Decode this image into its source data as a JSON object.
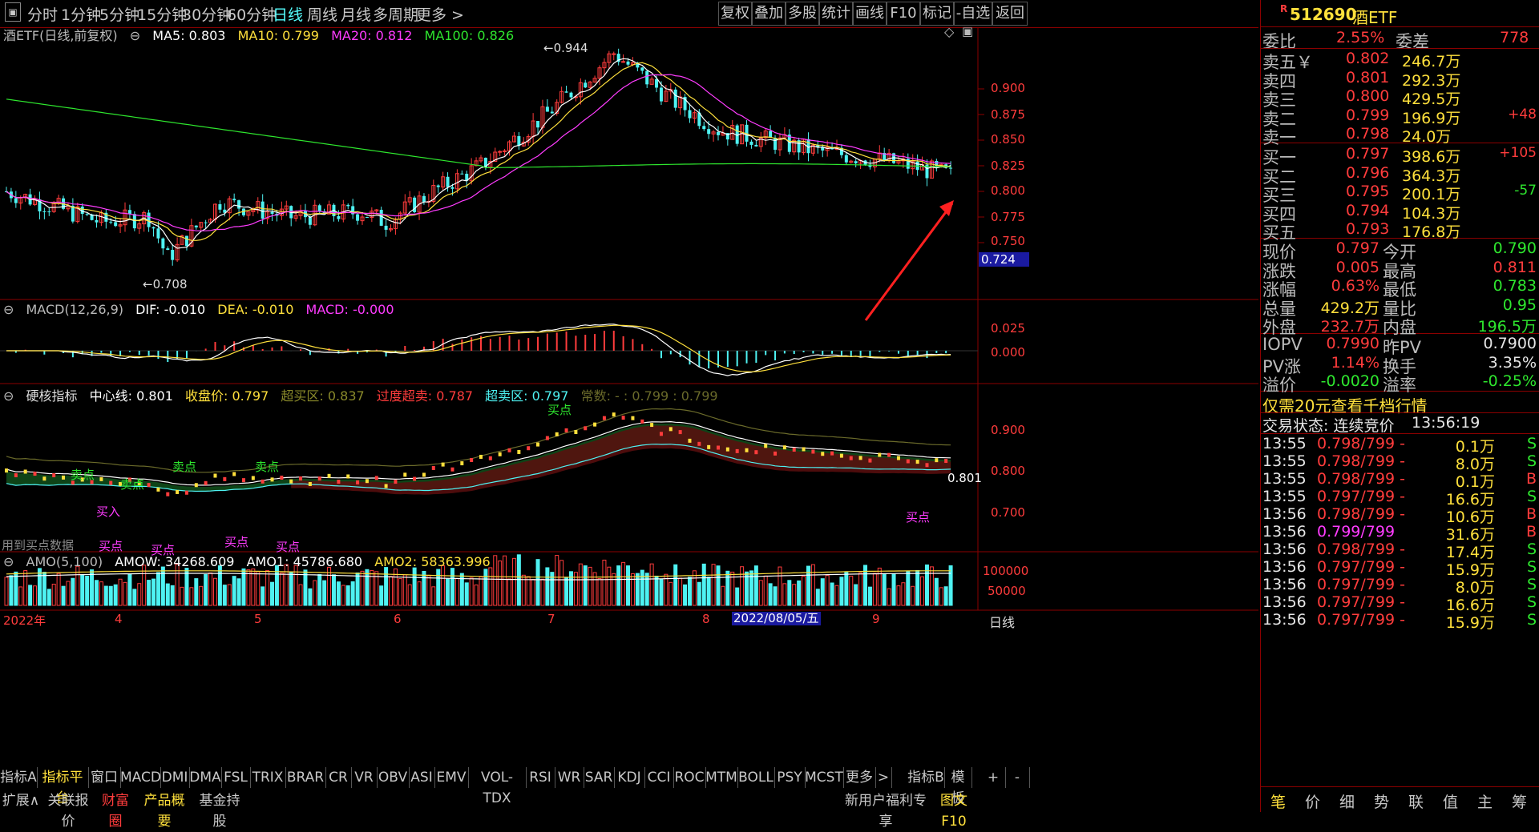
{
  "topbar": {
    "timeframes": [
      "分时",
      "1分钟",
      "5分钟",
      "15分钟",
      "30分钟",
      "60分钟",
      "日线",
      "周线",
      "月线",
      "多周期",
      "更多 >"
    ],
    "active": "日线",
    "buttons": [
      "复权",
      "叠加",
      "多股",
      "统计",
      "画线",
      "F10",
      "标记",
      "-自选",
      "返回"
    ]
  },
  "main_panel": {
    "title": "酒ETF(日线,前复权)",
    "ma": [
      {
        "label": "MA5: 0.803",
        "color": "#ffffff"
      },
      {
        "label": "MA10: 0.799",
        "color": "#ffe03c"
      },
      {
        "label": "MA20: 0.812",
        "color": "#ff3cff"
      },
      {
        "label": "MA100: 0.826",
        "color": "#2ee62e"
      }
    ],
    "high_label": "0.944",
    "low_label": "0.708",
    "price_axis": [
      "0.900",
      "0.875",
      "0.850",
      "0.825",
      "0.800",
      "0.775",
      "0.750"
    ],
    "cursor_price": "0.724"
  },
  "macd_panel": {
    "title": "MACD(12,26,9)",
    "dif": "DIF: -0.010",
    "dea": "DEA: -0.010",
    "macd": "MACD: -0.000",
    "axis": [
      "0.025",
      "0.000"
    ]
  },
  "hard_panel": {
    "title": "硬核指标",
    "center": "中心线: 0.801",
    "close": "收盘价: 0.797",
    "overbuy": "超买区: 0.837",
    "over_sell": "过度超卖: 0.787",
    "oversell": "超卖区: 0.797",
    "const": "常数: - : 0.799 : 0.799",
    "axis": [
      "0.900",
      "0.800",
      "0.700"
    ],
    "last_value": "0.801",
    "labels": {
      "sell1": "卖点",
      "sell2": "卖点",
      "sell3": "卖点",
      "sell4": "卖点",
      "buyin": "买入",
      "buy1": "买点",
      "buy2": "买点",
      "buy3": "买点",
      "buy4": "买点",
      "buy5": "买点",
      "buy6": "买点",
      "bought_data": "用到买点数据"
    }
  },
  "amo_panel": {
    "title": "AMO(5,100)",
    "amow": "AMOW: 34268.609",
    "amo1": "AMO1: 45786.680",
    "amo2": "AMO2: 58363.996",
    "axis": [
      "100000",
      "50000"
    ]
  },
  "date_axis": {
    "labels": [
      "2022年",
      "4",
      "5",
      "6",
      "7",
      "8",
      "9"
    ],
    "cursor_date": "2022/08/05/五",
    "period": "日线"
  },
  "tabs_row1": [
    "指标A",
    "指标平台",
    "窗口",
    "MACD",
    "DMI",
    "DMA",
    "FSL",
    "TRIX",
    "BRAR",
    "CR",
    "VR",
    "OBV",
    "ASI",
    "EMV",
    "VOL-TDX",
    "RSI",
    "WR",
    "SAR",
    "KDJ",
    "CCI",
    "ROC",
    "MTM",
    "BOLL",
    "PSY",
    "MCST",
    "更多",
    ">",
    "指标B",
    "模 板",
    "+",
    "-"
  ],
  "tabs_row2": [
    "扩展∧",
    "关联报价",
    "财富圈",
    "产品概要",
    "基金持股",
    "新用户福利专享",
    "图文F10"
  ],
  "quote": {
    "code": "512690",
    "name": "酒ETF",
    "badge": "R",
    "weibi_label": "委比",
    "weibi": "2.55%",
    "weicha_label": "委差",
    "weicha": "778",
    "sells": [
      {
        "label": "卖五￥",
        "price": "0.802",
        "vol": "246.7万",
        "chg": ""
      },
      {
        "label": "卖四",
        "price": "0.801",
        "vol": "292.3万",
        "chg": ""
      },
      {
        "label": "卖三",
        "price": "0.800",
        "vol": "429.5万",
        "chg": ""
      },
      {
        "label": "卖二",
        "price": "0.799",
        "vol": "196.9万",
        "chg": "+48"
      },
      {
        "label": "卖一",
        "price": "0.798",
        "vol": "24.0万",
        "chg": ""
      }
    ],
    "buys": [
      {
        "label": "买一",
        "price": "0.797",
        "vol": "398.6万",
        "chg": "+105"
      },
      {
        "label": "买二",
        "price": "0.796",
        "vol": "364.3万",
        "chg": ""
      },
      {
        "label": "买三",
        "price": "0.795",
        "vol": "200.1万",
        "chg": "-57"
      },
      {
        "label": "买四",
        "price": "0.794",
        "vol": "104.3万",
        "chg": ""
      },
      {
        "label": "买五",
        "price": "0.793",
        "vol": "176.8万",
        "chg": ""
      }
    ],
    "stats": [
      {
        "l1": "现价",
        "v1": "0.797",
        "l2": "今开",
        "v2": "0.790"
      },
      {
        "l1": "涨跌",
        "v1": "0.005",
        "l2": "最高",
        "v2": "0.811"
      },
      {
        "l1": "涨幅",
        "v1": "0.63%",
        "l2": "最低",
        "v2": "0.783"
      },
      {
        "l1": "总量",
        "v1": "429.2万",
        "l2": "量比",
        "v2": "0.95"
      },
      {
        "l1": "外盘",
        "v1": "232.7万",
        "l2": "内盘",
        "v2": "196.5万"
      }
    ],
    "iopv": [
      {
        "l1": "IOPV",
        "v1": "0.7990",
        "l2": "昨PV",
        "v2": "0.7900"
      },
      {
        "l1": "PV涨",
        "v1": "1.14%",
        "l2": "换手",
        "v2": "3.35%"
      },
      {
        "l1": "溢价",
        "v1": "-0.0020",
        "l2": "溢率",
        "v2": "-0.25%"
      }
    ],
    "promo": "仅需20元查看千档行情",
    "state_label": "交易状态: 连续竞价",
    "state_time": "13:56:19",
    "trades": [
      {
        "t": "13:55",
        "p": "0.798/799 -",
        "v": "0.1万",
        "s": "S"
      },
      {
        "t": "13:55",
        "p": "0.798/799 -",
        "v": "8.0万",
        "s": "S"
      },
      {
        "t": "13:55",
        "p": "0.798/799 -",
        "v": "0.1万",
        "s": "B"
      },
      {
        "t": "13:55",
        "p": "0.797/799 -",
        "v": "16.6万",
        "s": "S"
      },
      {
        "t": "13:56",
        "p": "0.798/799 -",
        "v": "10.6万",
        "s": "B"
      },
      {
        "t": "13:56",
        "p": "0.799/799",
        "v": "31.6万",
        "s": "B"
      },
      {
        "t": "13:56",
        "p": "0.798/799 -",
        "v": "17.4万",
        "s": "S"
      },
      {
        "t": "13:56",
        "p": "0.797/799 -",
        "v": "15.9万",
        "s": "S"
      },
      {
        "t": "13:56",
        "p": "0.797/799 -",
        "v": "8.0万",
        "s": "S"
      },
      {
        "t": "13:56",
        "p": "0.797/799 -",
        "v": "16.6万",
        "s": "S"
      },
      {
        "t": "13:56",
        "p": "0.797/799 -",
        "v": "15.9万",
        "s": "S"
      }
    ],
    "bottom_tabs": [
      "笔",
      "价",
      "细",
      "势",
      "联",
      "值",
      "主",
      "筹"
    ]
  },
  "colors": {
    "up": "#ff3c3c",
    "down": "#4ef2f2",
    "ma5": "#ffffff",
    "ma10": "#ffe03c",
    "ma20": "#ff3cff",
    "ma100": "#2ee62e",
    "frame": "#8b0000"
  }
}
